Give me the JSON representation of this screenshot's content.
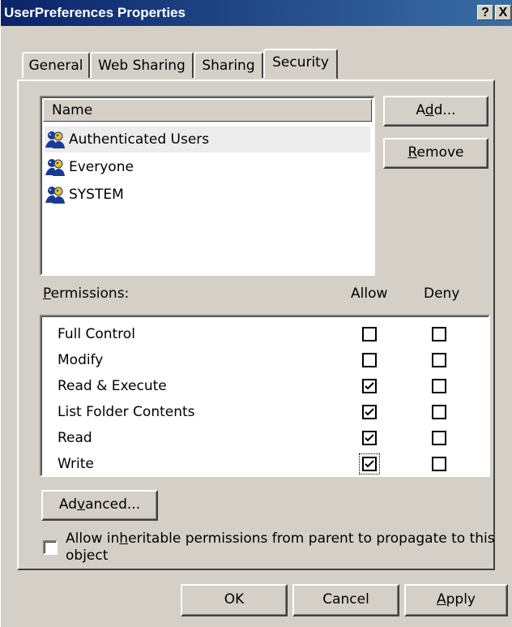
{
  "window": {
    "title": "UserPreferences Properties",
    "help_button": "?",
    "close_button": "X"
  },
  "tabs": [
    {
      "label": "General",
      "active": false
    },
    {
      "label": "Web Sharing",
      "active": false
    },
    {
      "label": "Sharing",
      "active": false
    },
    {
      "label": "Security",
      "active": true
    }
  ],
  "users_list": {
    "header": "Name",
    "items": [
      {
        "name": "Authenticated Users",
        "selected": true
      },
      {
        "name": "Everyone",
        "selected": false
      },
      {
        "name": "SYSTEM",
        "selected": false
      }
    ]
  },
  "buttons": {
    "add": {
      "pre": "A",
      "accel": "d",
      "post": "d..."
    },
    "remove": {
      "pre": "",
      "accel": "R",
      "post": "emove"
    },
    "advanced": {
      "pre": "Ad",
      "accel": "v",
      "post": "anced..."
    },
    "ok": "OK",
    "cancel": "Cancel",
    "apply": {
      "pre": "",
      "accel": "A",
      "post": "pply"
    }
  },
  "permissions": {
    "label": {
      "pre": "",
      "accel": "P",
      "post": "ermissions:"
    },
    "allow_header": "Allow",
    "deny_header": "Deny",
    "rows": [
      {
        "name": "Full Control",
        "allow": false,
        "deny": false
      },
      {
        "name": "Modify",
        "allow": false,
        "deny": false
      },
      {
        "name": "Read & Execute",
        "allow": true,
        "deny": false
      },
      {
        "name": "List Folder Contents",
        "allow": true,
        "deny": false
      },
      {
        "name": "Read",
        "allow": true,
        "deny": false
      },
      {
        "name": "Write",
        "allow": true,
        "deny": false
      }
    ]
  },
  "inherit": {
    "checked": false,
    "line1": {
      "pre": "Allow in",
      "accel": "h",
      "post": "eritable permissions from parent to propagate to this"
    },
    "line2": "object"
  },
  "colors": {
    "title_bar_start": "#0a246a",
    "title_bar_end": "#3a6ea5",
    "face": "#d4d0c8",
    "user_icon_blue": "#1a3a9a",
    "user_icon_yellow": "#e8c020"
  }
}
